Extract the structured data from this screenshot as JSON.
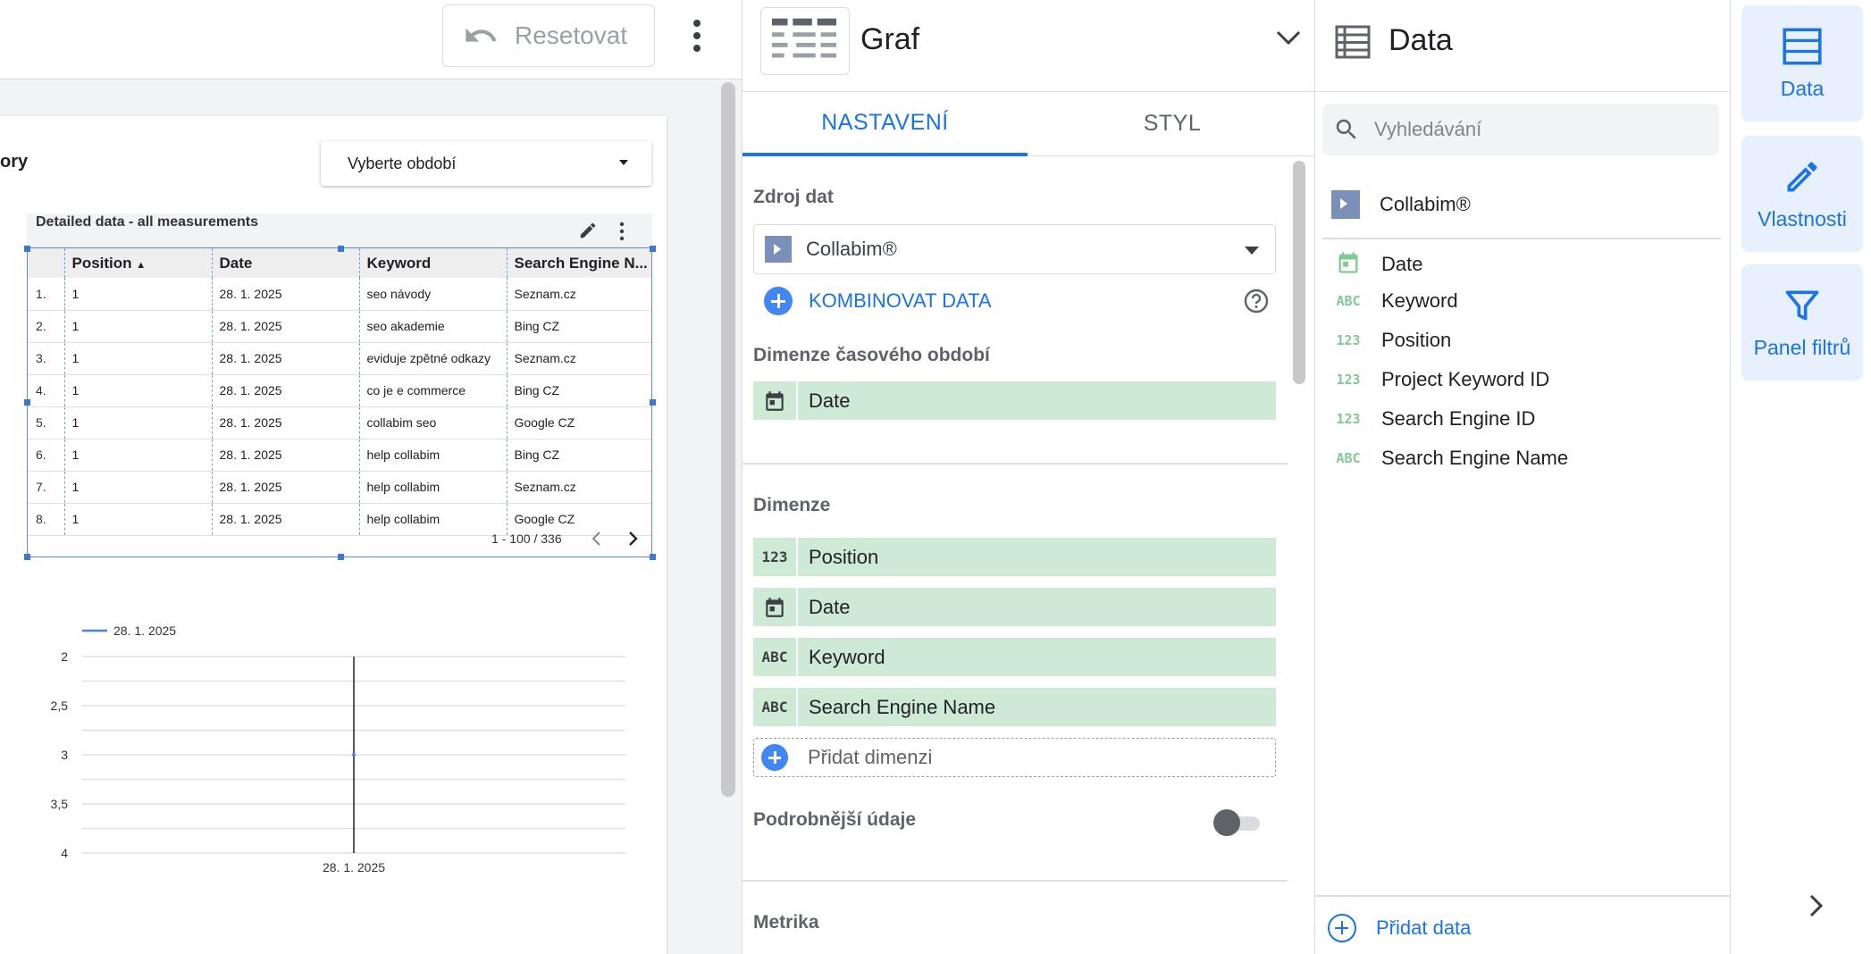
{
  "toolbar": {
    "reset_label": "Resetovat"
  },
  "report": {
    "title_fragment": "ory",
    "period_dropdown": "Vyberte období"
  },
  "table": {
    "title": "Detailed data - all measurements",
    "columns": [
      "Position",
      "Date",
      "Keyword",
      "Search Engine N..."
    ],
    "rows": [
      [
        "1.",
        "1",
        "28. 1. 2025",
        "seo návody",
        "Seznam.cz"
      ],
      [
        "2.",
        "1",
        "28. 1. 2025",
        "seo akademie",
        "Bing CZ"
      ],
      [
        "3.",
        "1",
        "28. 1. 2025",
        "eviduje zpětné odkazy",
        "Seznam.cz"
      ],
      [
        "4.",
        "1",
        "28. 1. 2025",
        "co je e commerce",
        "Bing CZ"
      ],
      [
        "5.",
        "1",
        "28. 1. 2025",
        "collabim seo",
        "Google CZ"
      ],
      [
        "6.",
        "1",
        "28. 1. 2025",
        "help collabim",
        "Bing CZ"
      ],
      [
        "7.",
        "1",
        "28. 1. 2025",
        "help collabim",
        "Seznam.cz"
      ],
      [
        "8.",
        "1",
        "28. 1. 2025",
        "help collabim",
        "Google CZ"
      ]
    ],
    "pagination": "1 - 100 / 336"
  },
  "chart_data": {
    "type": "line",
    "title": "",
    "xlabel": "",
    "ylabel": "",
    "x": [
      "28. 1. 2025"
    ],
    "series": [
      {
        "name": "28. 1. 2025",
        "values": [
          3
        ],
        "color": "#4285f4"
      }
    ],
    "y_ticks": [
      "2",
      "2,5",
      "3",
      "3,5",
      "4"
    ],
    "ylim": [
      2,
      4
    ],
    "y_reversed": true,
    "legend": "top-left",
    "grid": true
  },
  "chart_panel": {
    "title": "Graf",
    "tabs": [
      "NASTAVENÍ",
      "STYL"
    ],
    "data_source_label": "Zdroj dat",
    "data_source": "Collabim®",
    "blend_label": "KOMBINOVAT DATA",
    "date_range_label": "Dimenze časového období",
    "date_range_dim": {
      "type": "date",
      "name": "Date"
    },
    "dimensions_label": "Dimenze",
    "dimensions": [
      {
        "type": "123",
        "name": "Position"
      },
      {
        "type": "date",
        "name": "Date"
      },
      {
        "type": "ABC",
        "name": "Keyword"
      },
      {
        "type": "ABC",
        "name": "Search Engine Name"
      }
    ],
    "add_dimension": "Přidat dimenzi",
    "drill_down_label": "Podrobnější údaje",
    "drill_down_on": false,
    "metric_label": "Metrika"
  },
  "data_panel": {
    "title": "Data",
    "search_placeholder": "Vyhledávání",
    "source": "Collabim®",
    "fields": [
      {
        "type": "date",
        "name": "Date"
      },
      {
        "type": "ABC",
        "name": "Keyword"
      },
      {
        "type": "123",
        "name": "Position"
      },
      {
        "type": "123",
        "name": "Project Keyword ID"
      },
      {
        "type": "123",
        "name": "Search Engine ID"
      },
      {
        "type": "ABC",
        "name": "Search Engine Name"
      }
    ],
    "add_data": "Přidat data"
  },
  "rail": {
    "data": "Data",
    "properties": "Vlastnosti",
    "filters": "Panel filtrů"
  }
}
